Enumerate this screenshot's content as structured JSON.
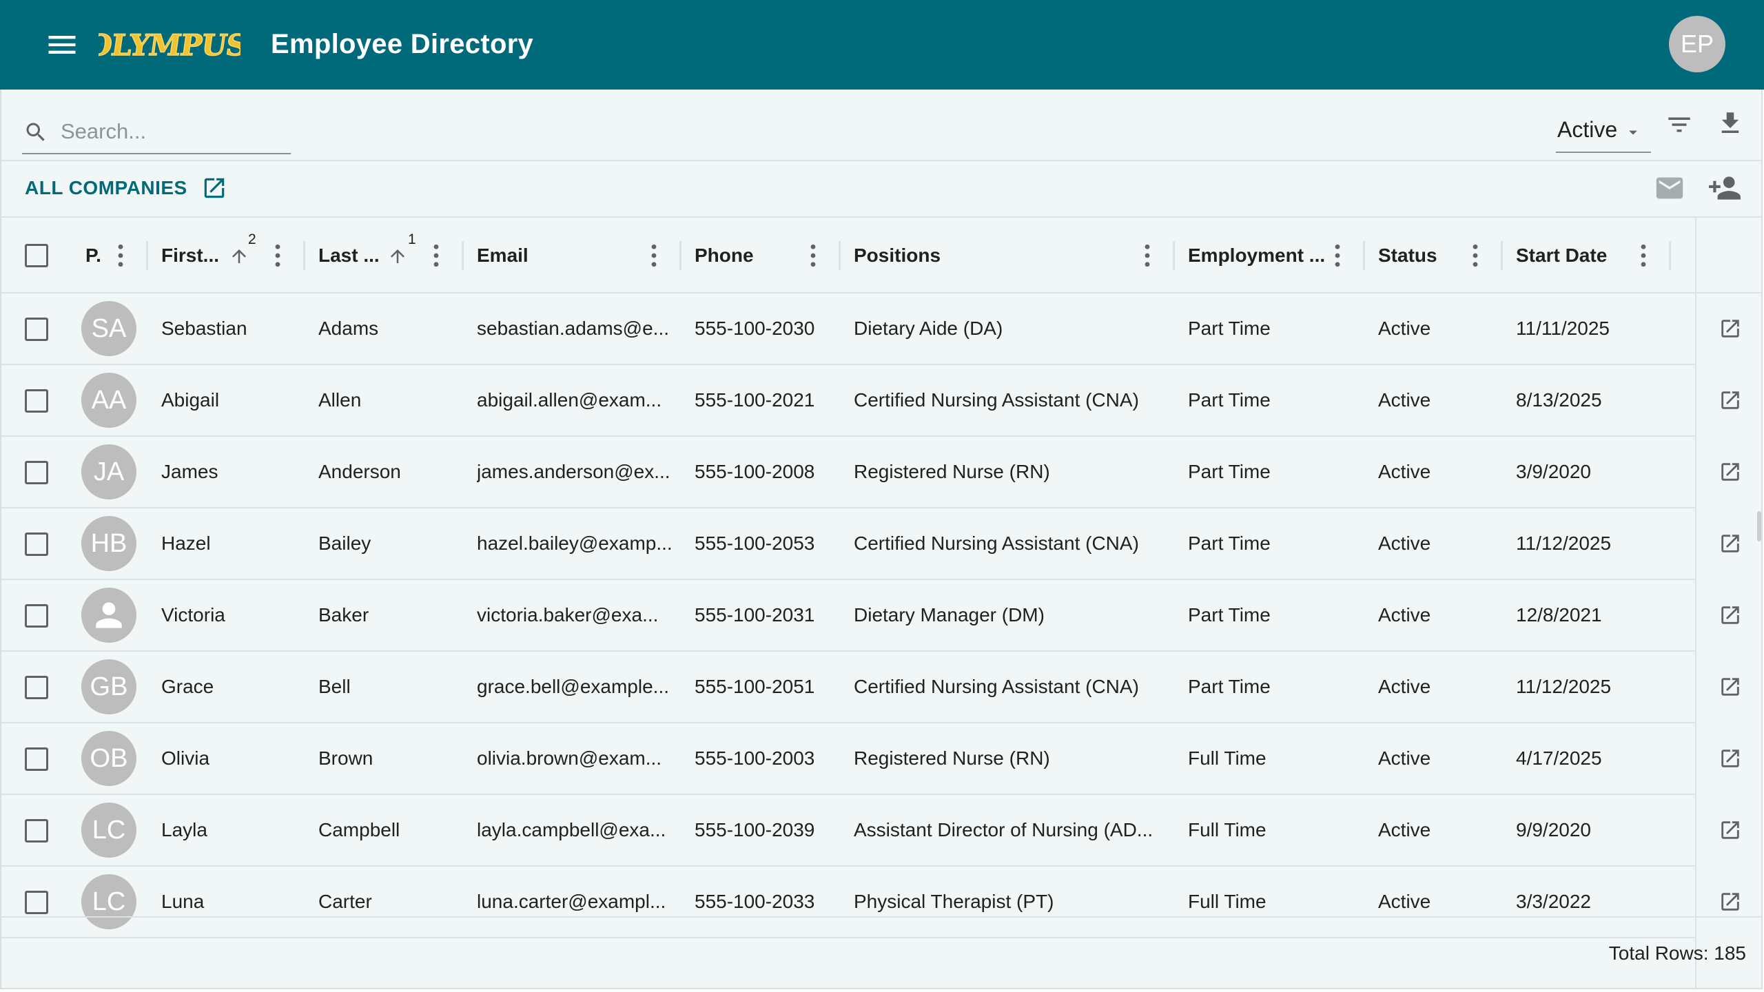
{
  "app": {
    "title": "Employee Directory",
    "user_initials": "EP",
    "brand": "OLYMPUS"
  },
  "toolbar": {
    "search_placeholder": "Search...",
    "status_value": "Active"
  },
  "subbar": {
    "all_companies_label": "ALL COMPANIES"
  },
  "columns": [
    {
      "key": "photo",
      "label": "P."
    },
    {
      "key": "first",
      "label": "First...",
      "sort_order": "2"
    },
    {
      "key": "last",
      "label": "Last ...",
      "sort_order": "1"
    },
    {
      "key": "email",
      "label": "Email"
    },
    {
      "key": "phone",
      "label": "Phone"
    },
    {
      "key": "positions",
      "label": "Positions"
    },
    {
      "key": "employment",
      "label": "Employment ..."
    },
    {
      "key": "status",
      "label": "Status"
    },
    {
      "key": "start",
      "label": "Start Date"
    }
  ],
  "rows": [
    {
      "initials": "SA",
      "first": "Sebastian",
      "last": "Adams",
      "email": "sebastian.adams@e...",
      "phone": "555-100-2030",
      "position": "Dietary Aide (DA)",
      "employment": "Part Time",
      "status": "Active",
      "start": "11/11/2025"
    },
    {
      "initials": "AA",
      "first": "Abigail",
      "last": "Allen",
      "email": "abigail.allen@exam...",
      "phone": "555-100-2021",
      "position": "Certified Nursing Assistant (CNA)",
      "employment": "Part Time",
      "status": "Active",
      "start": "8/13/2025"
    },
    {
      "initials": "JA",
      "first": "James",
      "last": "Anderson",
      "email": "james.anderson@ex...",
      "phone": "555-100-2008",
      "position": "Registered Nurse (RN)",
      "employment": "Part Time",
      "status": "Active",
      "start": "3/9/2020"
    },
    {
      "initials": "HB",
      "first": "Hazel",
      "last": "Bailey",
      "email": "hazel.bailey@examp...",
      "phone": "555-100-2053",
      "position": "Certified Nursing Assistant (CNA)",
      "employment": "Part Time",
      "status": "Active",
      "start": "11/12/2025"
    },
    {
      "initials": "",
      "first": "Victoria",
      "last": "Baker",
      "email": "victoria.baker@exa...",
      "phone": "555-100-2031",
      "position": "Dietary Manager (DM)",
      "employment": "Part Time",
      "status": "Active",
      "start": "12/8/2021"
    },
    {
      "initials": "GB",
      "first": "Grace",
      "last": "Bell",
      "email": "grace.bell@example...",
      "phone": "555-100-2051",
      "position": "Certified Nursing Assistant (CNA)",
      "employment": "Part Time",
      "status": "Active",
      "start": "11/12/2025"
    },
    {
      "initials": "OB",
      "first": "Olivia",
      "last": "Brown",
      "email": "olivia.brown@exam...",
      "phone": "555-100-2003",
      "position": "Registered Nurse (RN)",
      "employment": "Full Time",
      "status": "Active",
      "start": "4/17/2025"
    },
    {
      "initials": "LC",
      "first": "Layla",
      "last": "Campbell",
      "email": "layla.campbell@exa...",
      "phone": "555-100-2039",
      "position": "Assistant Director of Nursing (AD...",
      "employment": "Full Time",
      "status": "Active",
      "start": "9/9/2020"
    },
    {
      "initials": "LC",
      "first": "Luna",
      "last": "Carter",
      "email": "luna.carter@exampl...",
      "phone": "555-100-2033",
      "position": "Physical Therapist (PT)",
      "employment": "Full Time",
      "status": "Active",
      "start": "3/3/2022"
    }
  ],
  "footer": {
    "total_rows": "Total Rows: 185"
  },
  "colors": {
    "appbar": "#006a7a",
    "accent": "#006a7a",
    "panel_bg": "#f1f7f7",
    "avatar_bg": "#bdbdbd"
  }
}
